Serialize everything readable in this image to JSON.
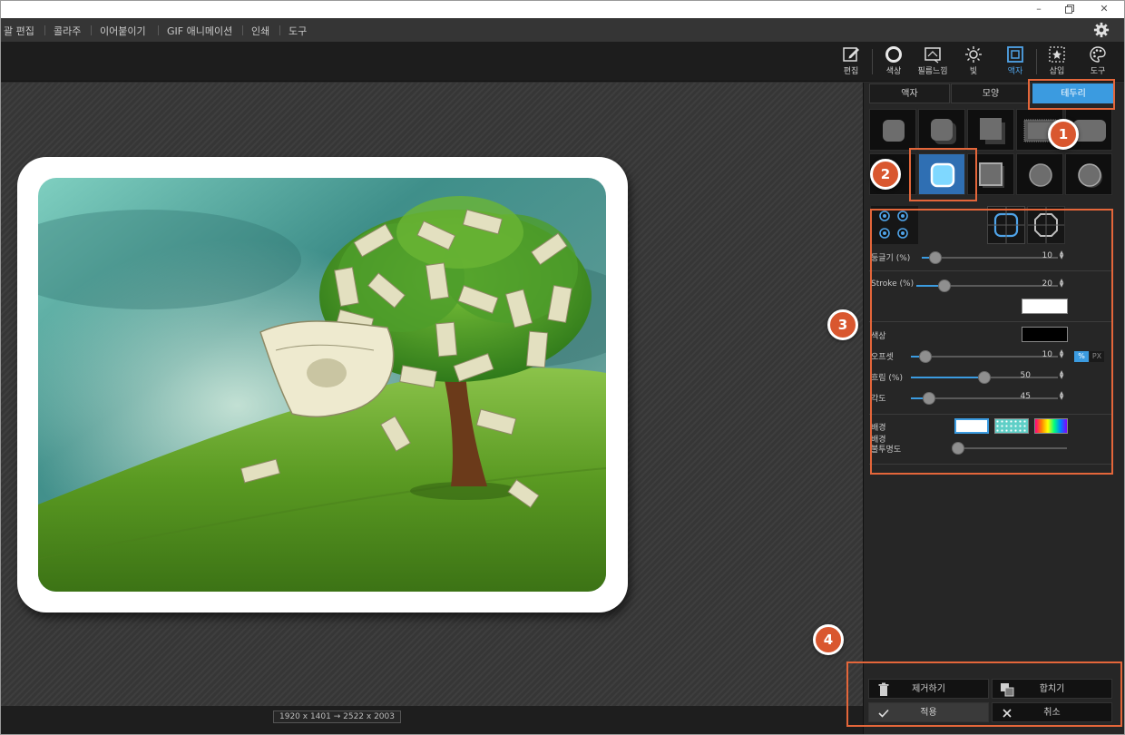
{
  "menu": {
    "items": [
      "괄 편집",
      "콜라주",
      "이어붙이기",
      "GIF 애니메이션",
      "인쇄",
      "도구"
    ]
  },
  "toolbar": {
    "tools": [
      {
        "label": "편집",
        "icon": "edit-icon"
      },
      {
        "label": "색상",
        "icon": "color-circle-icon"
      },
      {
        "label": "필름느낌",
        "icon": "film-icon"
      },
      {
        "label": "빛",
        "icon": "light-icon"
      },
      {
        "label": "액자",
        "icon": "frame-icon",
        "active": true
      },
      {
        "label": "삽입",
        "icon": "insert-icon"
      },
      {
        "label": "도구",
        "icon": "palette-icon"
      }
    ]
  },
  "status": {
    "size_readout": "1920 x 1401 → 2522 x 2003"
  },
  "panel": {
    "tabs": [
      {
        "label": "액자",
        "active": false
      },
      {
        "label": "모양",
        "active": false
      },
      {
        "label": "테두리",
        "active": true
      }
    ],
    "props": {
      "roundness_label": "둥글기 (%)",
      "roundness_value": "10",
      "stroke_label": "Stroke (%)",
      "stroke_value": "20",
      "stroke_color": "#ffffff",
      "color_label": "색상",
      "shadow_color": "#000000",
      "offset_label": "오프셋",
      "offset_value": "10",
      "unit_percent": "%",
      "unit_px": "PX",
      "blur_label": "흐림 (%)",
      "blur_value": "50",
      "angle_label": "각도",
      "angle_value": "45",
      "background_label": "배경",
      "background_opacity_label_1": "배경",
      "background_opacity_label_2": "불투명도"
    },
    "levels": {
      "roundness": 10,
      "stroke": 20,
      "offset": 10,
      "blur": 50,
      "angle": 45,
      "background_opacity": 0
    }
  },
  "actions": {
    "remove": "제거하기",
    "merge": "합치기",
    "apply": "적용",
    "cancel": "취소"
  },
  "annotations": {
    "markers": [
      "1",
      "2",
      "3",
      "4"
    ],
    "highlight_color": "#e4663a"
  },
  "colors": {
    "accent": "#3b9be0",
    "marker": "#d9572f"
  }
}
